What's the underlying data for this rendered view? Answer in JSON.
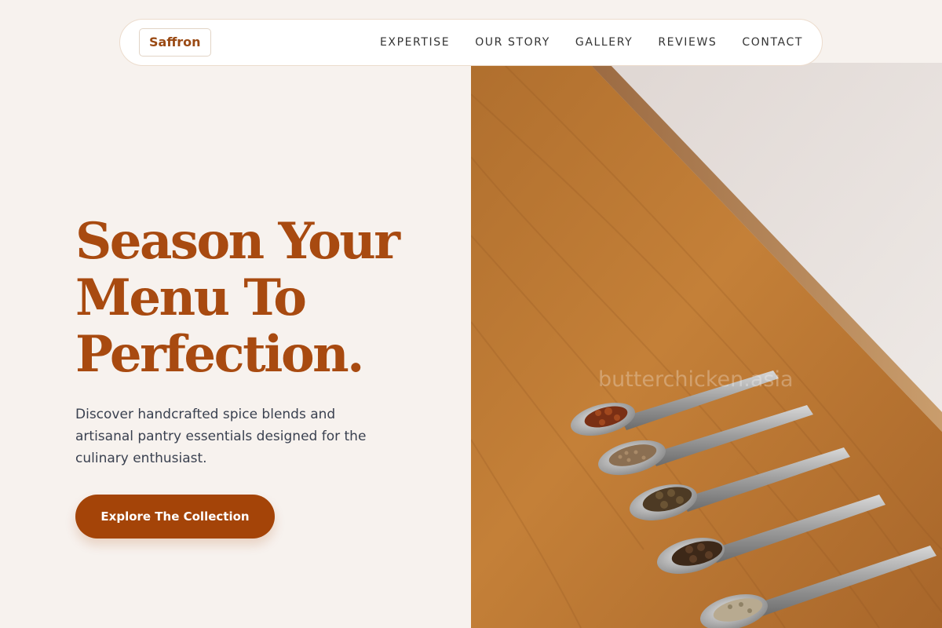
{
  "brand": {
    "name": "Saffron"
  },
  "nav": {
    "items": [
      {
        "label": "EXPERTISE"
      },
      {
        "label": "OUR STORY"
      },
      {
        "label": "GALLERY"
      },
      {
        "label": "REVIEWS"
      },
      {
        "label": "CONTACT"
      }
    ]
  },
  "hero": {
    "title_lines": [
      "Season Your",
      "Menu To",
      "Perfection."
    ],
    "subtitle": "Discover handcrafted spice blends and artisanal pantry essentials designed for the culinary enthusiast.",
    "cta_label": "Explore The Collection",
    "image_watermark": "butterchicken.asia"
  },
  "colors": {
    "background": "#f7f2ee",
    "accent": "#a84a10",
    "button": "#a44408",
    "text": "#3a4150"
  }
}
